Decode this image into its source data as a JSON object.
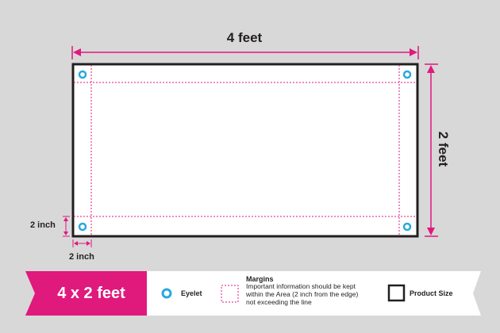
{
  "dimensions": {
    "width_label": "4 feet",
    "height_label": "2 feet",
    "margin_vertical_label": "2 inch",
    "margin_horizontal_label": "2 inch"
  },
  "badge": {
    "text": "4 x 2 feet"
  },
  "legend": {
    "eyelet": "Eyelet",
    "margins_title": "Margins",
    "margins_lines": [
      "Important information should be kept",
      "within the Area (2 inch from the edge)",
      "not exceeding the line"
    ],
    "product_size": "Product Size"
  },
  "colors": {
    "background": "#d8d8d8",
    "accent_magenta": "#e0197d",
    "eyelet_blue": "#29a8e0",
    "outline": "#231f20",
    "white": "#ffffff"
  },
  "icons": [
    "eyelet-icon",
    "margin-box-icon",
    "product-size-icon",
    "arrow-icon"
  ]
}
